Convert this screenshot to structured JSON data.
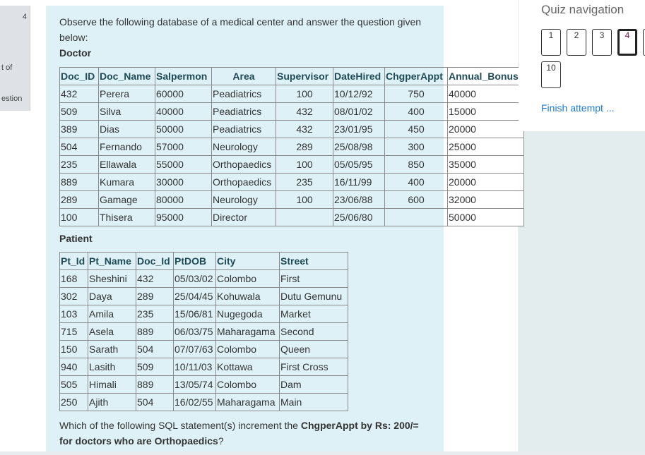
{
  "sidebar": {
    "frag1": "4",
    "frag2": "t of",
    "frag3": "estion"
  },
  "question": {
    "intro": "Observe the following database of a medical center and answer the question given below:",
    "doctor_title": "Doctor",
    "doctor_table": {
      "headers": [
        "Doc_ID",
        "Doc_Name",
        "Salpermon",
        "Area",
        "Supervisor",
        "DateHired",
        "ChgperAppt",
        "Annual_Bonus"
      ],
      "rows": [
        [
          "432",
          "Perera",
          "60000",
          "Peadiatrics",
          "100",
          "10/12/92",
          "750",
          "40000"
        ],
        [
          "509",
          "Silva",
          "40000",
          "Peadiatrics",
          "432",
          "08/01/02",
          "400",
          "15000"
        ],
        [
          "389",
          "Dias",
          "50000",
          "Peadiatrics",
          "432",
          "23/01/95",
          "450",
          "20000"
        ],
        [
          "504",
          "Fernando",
          "57000",
          "Neurology",
          "289",
          "25/08/98",
          "300",
          "25000"
        ],
        [
          "235",
          "Ellawala",
          "55000",
          "Orthopaedics",
          "100",
          "05/05/95",
          "850",
          "35000"
        ],
        [
          "889",
          "Kumara",
          "30000",
          "Orthopaedics",
          "235",
          "16/11/99",
          "400",
          "20000"
        ],
        [
          "289",
          "Gamage",
          "80000",
          "Neurology",
          "100",
          "23/06/88",
          "600",
          "32000"
        ],
        [
          "100",
          "Thisera",
          "95000",
          "Director",
          "",
          "25/06/80",
          "",
          "50000"
        ]
      ]
    },
    "patient_title": "Patient",
    "patient_table": {
      "headers": [
        "Pt_Id",
        "Pt_Name",
        "Doc_Id",
        "PtDOB",
        "City",
        "Street"
      ],
      "rows": [
        [
          "168",
          "Sheshini",
          "432",
          "05/03/02",
          "Colombo",
          "First"
        ],
        [
          "302",
          "Daya",
          "289",
          "25/04/45",
          "Kohuwala",
          "Dutu Gemunu"
        ],
        [
          "103",
          "Amila",
          "235",
          "15/06/81",
          "Nugegoda",
          "Market"
        ],
        [
          "715",
          "Asela",
          "889",
          "06/03/75",
          "Maharagama",
          "Second"
        ],
        [
          "150",
          "Sarath",
          "504",
          "07/07/63",
          "Colombo",
          "Queen"
        ],
        [
          "940",
          "Lasith",
          "509",
          "10/11/03",
          "Kottawa",
          "First Cross"
        ],
        [
          "505",
          "Himali",
          "889",
          "13/05/74",
          "Colombo",
          "Dam"
        ],
        [
          "250",
          "Ajith",
          "504",
          "16/02/55",
          "Maharagama",
          "Main"
        ]
      ]
    },
    "prompt_pre": "Which of the following SQL statement(s) increment the ",
    "prompt_bold1": "ChgperAppt by Rs: 200/= for doctors who are Orthopaedics",
    "prompt_post": "?"
  },
  "quiz_nav": {
    "title": "Quiz navigation",
    "buttons": [
      "1",
      "2",
      "3",
      "4",
      "10"
    ],
    "current": "4",
    "finish": "Finish attempt ..."
  }
}
